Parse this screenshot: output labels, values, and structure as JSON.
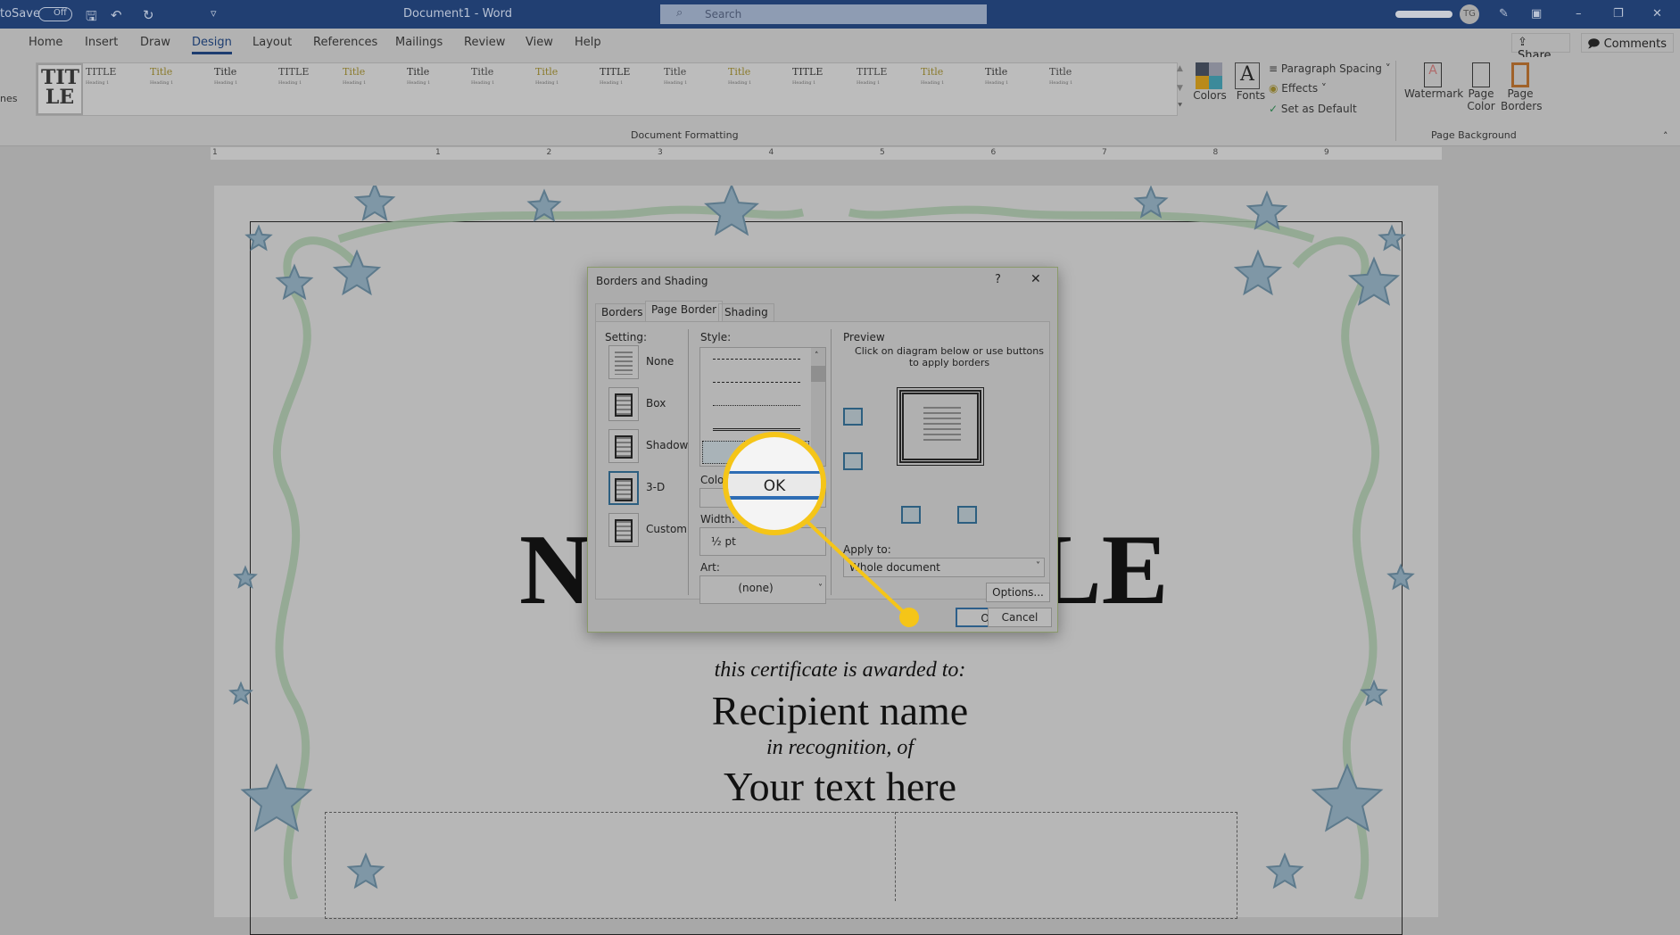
{
  "titlebar": {
    "autosave_label": "toSave",
    "autosave_state": "Off",
    "document_title": "Document1 - Word",
    "search_placeholder": "Search",
    "user_initials": "TG"
  },
  "tabs": [
    "Home",
    "Insert",
    "Draw",
    "Design",
    "Layout",
    "References",
    "Mailings",
    "Review",
    "View",
    "Help"
  ],
  "active_tab": "Design",
  "share_label": "Share",
  "comments_label": "Comments",
  "ribbon": {
    "gallery_first": "TIT LE",
    "gallery_titles": [
      "TITLE",
      "Title",
      "Title",
      "TITLE",
      "Title",
      "Title",
      "Title",
      "Title",
      "TITLE",
      "Title",
      "Title",
      "TITLE",
      "TITLE",
      "Title",
      "Title",
      "Title"
    ],
    "gallery_heading": "Heading 1",
    "group_document_formatting": "Document Formatting",
    "colors": "Colors",
    "fonts": "Fonts",
    "paragraph_spacing": "Paragraph Spacing",
    "effects": "Effects",
    "set_as_default": "Set as Default",
    "watermark": "Watermark",
    "page_color": "Page Color",
    "page_borders": "Page Borders",
    "group_page_background": "Page Background",
    "themes_partial": "nes"
  },
  "ruler_numbers": [
    "1",
    "1",
    "2",
    "3",
    "4",
    "5",
    "6",
    "7",
    "8",
    "9"
  ],
  "document": {
    "title_left": "N",
    "title_right": "LE",
    "awarded": "this certificate is awarded to:",
    "recipient": "Recipient name",
    "recognition": "in recognition, of",
    "your_text": "Your text here"
  },
  "dialog": {
    "title": "Borders and Shading",
    "help": "?",
    "close": "✕",
    "tabs": [
      "Borders",
      "Page Border",
      "Shading"
    ],
    "active_tab": "Page Border",
    "setting_label": "Setting:",
    "settings": [
      "None",
      "Box",
      "Shadow",
      "3-D",
      "Custom"
    ],
    "selected_setting": "3-D",
    "style_label": "Style:",
    "color_label": "Color:",
    "width_label": "Width:",
    "width_value": "½ pt",
    "art_label": "Art:",
    "art_value": "(none)",
    "preview_label": "Preview",
    "preview_hint": "Click on diagram below or use buttons to apply borders",
    "apply_to_label": "Apply to:",
    "apply_to_value": "Whole document",
    "options": "Options...",
    "ok": "OK",
    "cancel": "Cancel"
  },
  "callout": {
    "magnified_label": "OK",
    "color": "#f5c518"
  }
}
